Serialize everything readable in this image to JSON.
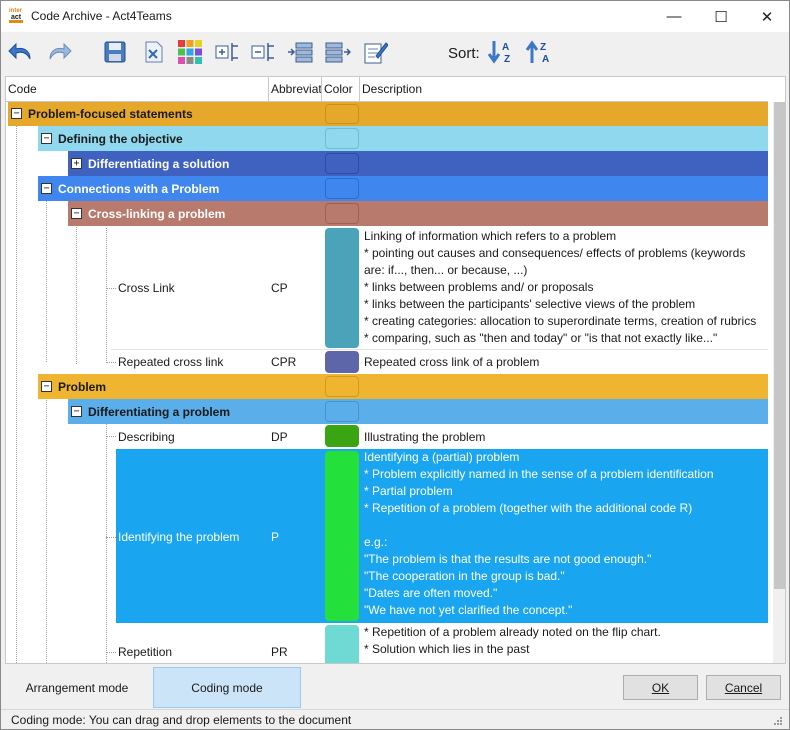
{
  "window": {
    "title": "Code Archive - Act4Teams",
    "icon_lines": [
      "inter",
      "act"
    ],
    "min_glyph": "—",
    "max_glyph": "☐",
    "close_glyph": "✕"
  },
  "toolbar": {
    "sort_label": "Sort:",
    "sort_asc_letters": "AZ",
    "sort_desc_letters": "ZA"
  },
  "grid": {
    "columns": [
      "Code",
      "Abbreviat",
      "Color",
      "Description"
    ],
    "groups": [
      {
        "label": "Problem-focused statements",
        "expander": "−",
        "color": "#e6a82a"
      },
      {
        "label": "Defining the objective",
        "expander": "−",
        "color": "#8fd8ee"
      },
      {
        "label": "Differentiating a solution",
        "expander": "+",
        "color": "#3f62c0",
        "text_color": "#ffffff"
      },
      {
        "label": "Connections with a Problem",
        "expander": "−",
        "color": "#3f86ee",
        "text_color": "#ffffff"
      },
      {
        "label": "Cross-linking a problem",
        "expander": "−",
        "color": "#b87a6c",
        "text_color": "#ffffff"
      },
      {
        "label": "Problem",
        "expander": "−",
        "color": "#efb531"
      },
      {
        "label": "Differentiating a problem",
        "expander": "−",
        "color": "#5aaeea"
      }
    ],
    "leaves": [
      {
        "code": "Cross Link",
        "abbr": "CP",
        "color": "#4aa3b8",
        "desc": [
          "Linking of information which refers to a problem",
          "* pointing out causes and consequences/ effects of problems (keywords",
          "are: if..., then... or because, ...)",
          "* links between problems and/ or proposals",
          "* links between the participants' selective views of the problem",
          "* creating categories: allocation to superordinate terms, creation of rubrics",
          "* comparing, such as \"then and today\" or \"is that not exactly like...\""
        ]
      },
      {
        "code": "Repeated cross link",
        "abbr": "CPR",
        "color": "#5d66a8",
        "desc": [
          "Repeated cross link of a problem"
        ]
      },
      {
        "code": "Describing",
        "abbr": "DP",
        "color": "#3aa412",
        "desc": [
          "Illustrating the problem"
        ]
      },
      {
        "code": "Identifying the problem",
        "abbr": "P",
        "color": "#23e03a",
        "selected": true,
        "desc": [
          "Identifying a (partial) problem",
          "* Problem explicitly named in the sense of a problem identification",
          "* Partial problem",
          "* Repetition of a problem (together with the additional code R)",
          "",
          "e.g.:",
          "\"The problem is that the results are not good enough.\"",
          "\"The cooperation in the group is bad.\"",
          "\"Dates are often moved.\"",
          "\"We have not yet clarified the concept.\""
        ]
      },
      {
        "code": "Repetition",
        "abbr": "PR",
        "color": "#6fd9d3",
        "desc": [
          "* Repetition of a problem already noted on the flip chart.",
          "* Solution which lies in the past"
        ]
      }
    ]
  },
  "bottom": {
    "arrangement_mode": "Arrangement mode",
    "coding_mode": "Coding mode",
    "ok": "OK",
    "cancel": "Cancel",
    "status": "Coding mode: You can drag and drop elements to the document"
  }
}
